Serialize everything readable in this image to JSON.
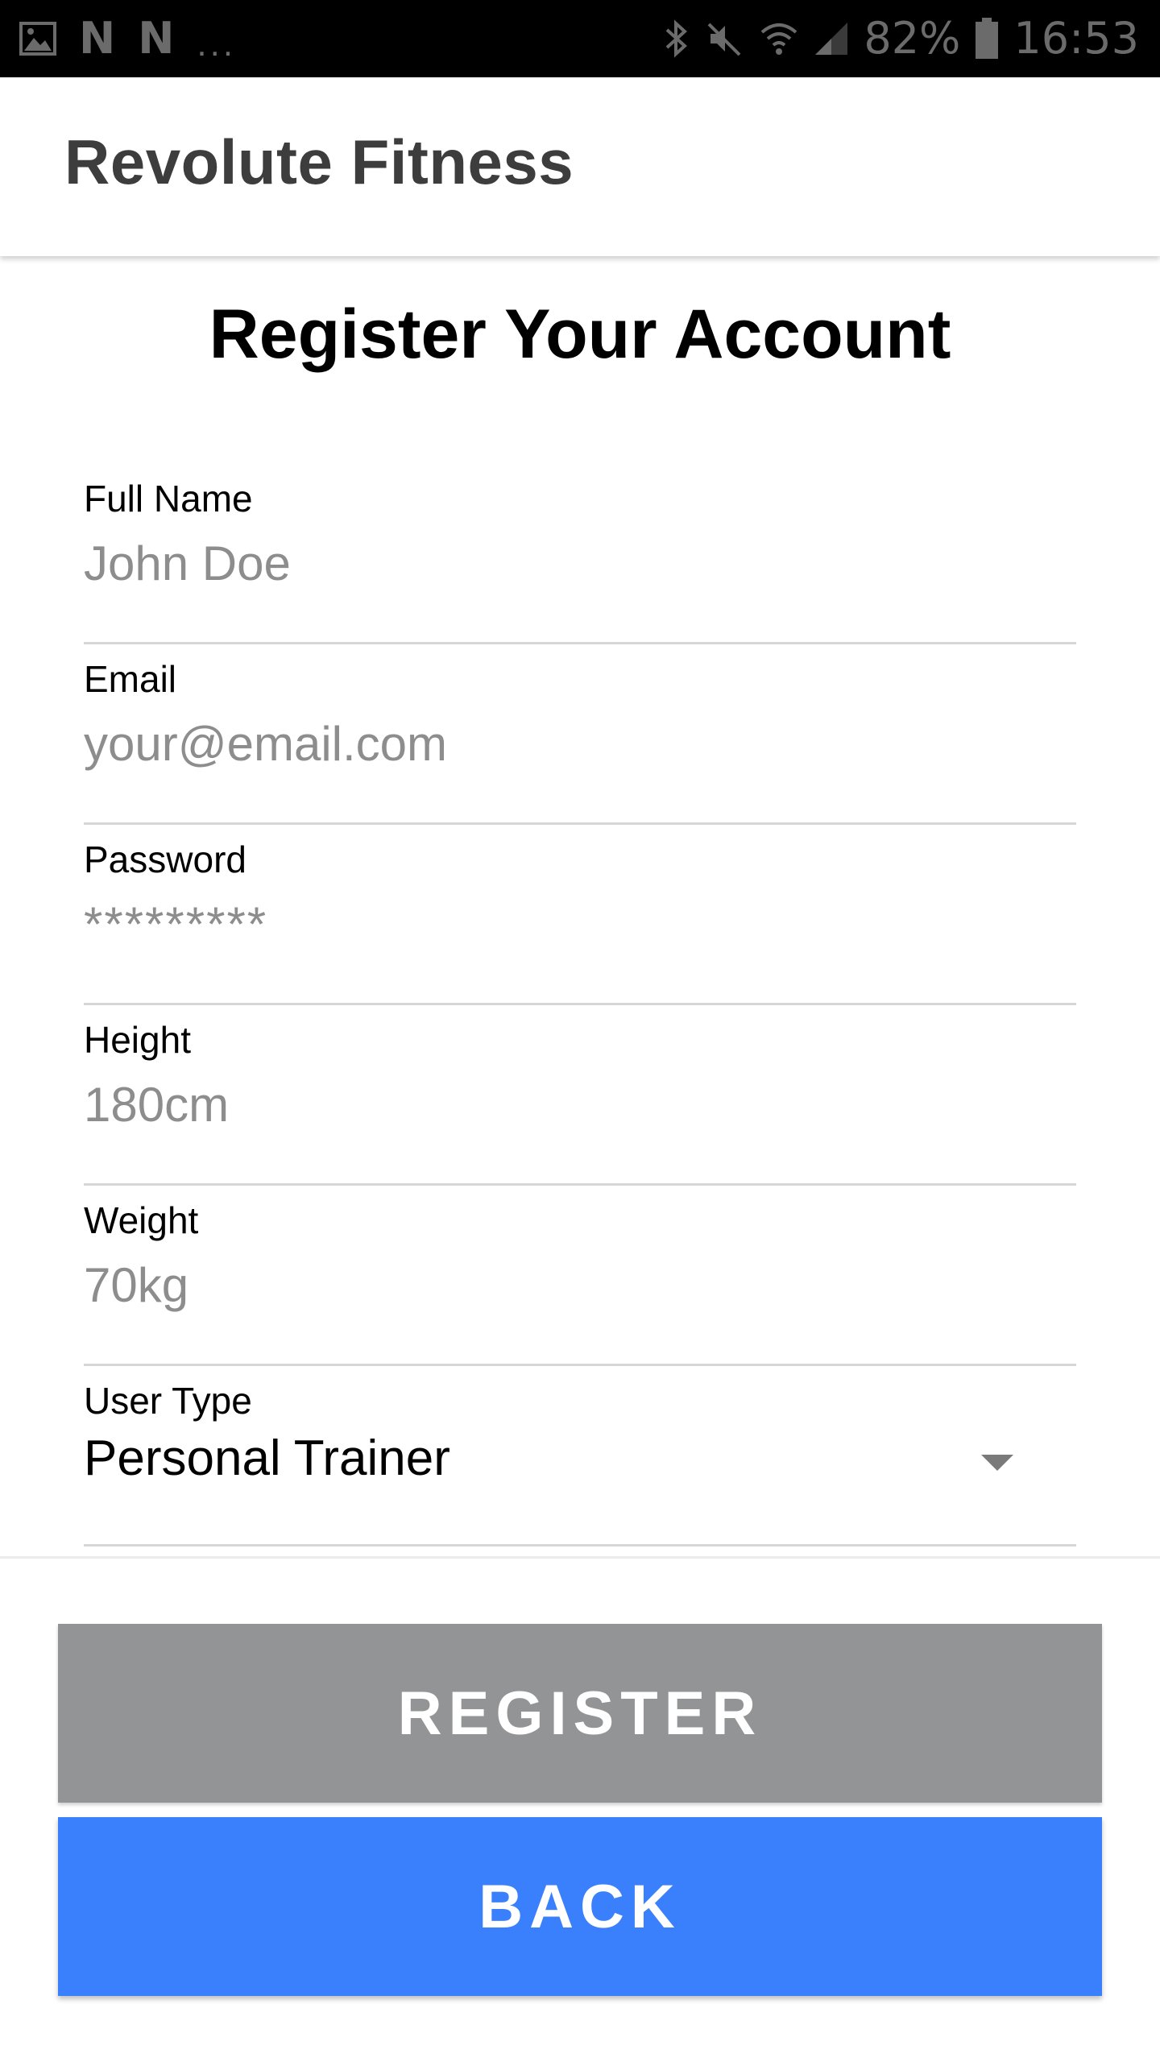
{
  "status_bar": {
    "left_icons": [
      "image-icon",
      "n-icon",
      "n-icon",
      "more-dots-icon"
    ],
    "n_glyph": "N",
    "dots": "...",
    "battery_percent": "82%",
    "time": "16:53",
    "right_icons": [
      "bluetooth-icon",
      "mute-icon",
      "wifi-icon",
      "signal-icon",
      "battery-icon"
    ]
  },
  "app_bar": {
    "title": "Revolute Fitness"
  },
  "page": {
    "heading": "Register Your Account"
  },
  "form": {
    "full_name": {
      "label": "Full Name",
      "placeholder": "John Doe"
    },
    "email": {
      "label": "Email",
      "placeholder": "your@email.com"
    },
    "password": {
      "label": "Password",
      "placeholder": "*********"
    },
    "height": {
      "label": "Height",
      "placeholder": "180cm"
    },
    "weight": {
      "label": "Weight",
      "placeholder": "70kg"
    },
    "user_type": {
      "label": "User Type",
      "selected": "Personal Trainer",
      "icon": "dropdown-caret-icon"
    }
  },
  "buttons": {
    "register": "REGISTER",
    "back": "BACK"
  },
  "colors": {
    "status_bar_bg": "#000000",
    "register_button": "#939496",
    "back_button": "#3a80fd",
    "placeholder_text": "#8d8d8d",
    "underline": "#d6d6d6"
  }
}
